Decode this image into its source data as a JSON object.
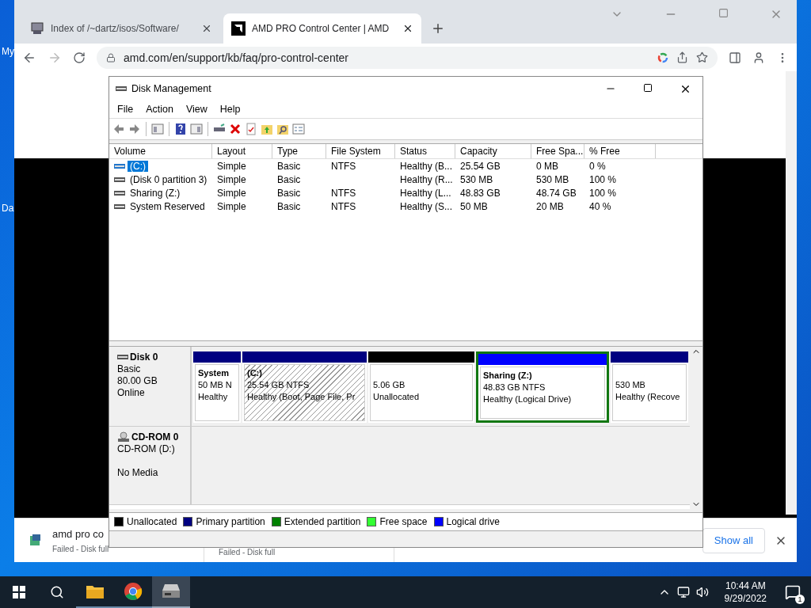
{
  "desktop": {
    "labels": [
      "My",
      "Da"
    ]
  },
  "browser": {
    "tabs": [
      {
        "title": "Index of /~dartz/isos/Software/",
        "selected": false,
        "kind": "computer"
      },
      {
        "title": "AMD PRO Control Center | AMD",
        "selected": true,
        "kind": "amd"
      }
    ],
    "address": "amd.com/en/support/kb/faq/pro-control-center",
    "downloads": [
      {
        "name": "amd pro co",
        "status": "Failed - Disk full"
      },
      {
        "status": "Failed - Disk full"
      }
    ],
    "show_all": "Show all"
  },
  "disk_management": {
    "title": "Disk Management",
    "menu": [
      "File",
      "Action",
      "View",
      "Help"
    ],
    "columns": [
      "Volume",
      "Layout",
      "Type",
      "File System",
      "Status",
      "Capacity",
      "Free Spa...",
      "% Free"
    ],
    "volumes": [
      {
        "cells": [
          "(C:)",
          "Simple",
          "Basic",
          "NTFS",
          "Healthy (B...",
          "25.54 GB",
          "0 MB",
          "0 %"
        ],
        "selected": true
      },
      {
        "cells": [
          "(Disk 0 partition 3)",
          "Simple",
          "Basic",
          "",
          "Healthy (R...",
          "530 MB",
          "530 MB",
          "100 %"
        ],
        "selected": false
      },
      {
        "cells": [
          "Sharing (Z:)",
          "Simple",
          "Basic",
          "NTFS",
          "Healthy (L...",
          "48.83 GB",
          "48.74 GB",
          "100 %"
        ],
        "selected": false
      },
      {
        "cells": [
          "System Reserved",
          "Simple",
          "Basic",
          "NTFS",
          "Healthy (S...",
          "50 MB",
          "20 MB",
          "40 %"
        ],
        "selected": false
      }
    ],
    "disks": [
      {
        "kind": "disk",
        "name": "Disk 0",
        "lines": [
          "Basic",
          "80.00 GB",
          "Online"
        ],
        "partitions": [
          {
            "kind": "primary",
            "title": "System",
            "size": "50 MB N",
            "status": "Healthy",
            "selected": false,
            "in_extended": false
          },
          {
            "kind": "primary",
            "title": "(C:)",
            "size": "25.54 GB NTFS",
            "status": "Healthy (Boot, Page File, Pr",
            "selected": true,
            "in_extended": false
          },
          {
            "kind": "unallocated",
            "size": "5.06 GB",
            "status": "Unallocated",
            "selected": false,
            "in_extended": false
          },
          {
            "kind": "logical",
            "title": "Sharing  (Z:)",
            "size": "48.83 GB NTFS",
            "status": "Healthy (Logical Drive)",
            "selected": false,
            "in_extended": true
          },
          {
            "kind": "primary",
            "size": "530 MB",
            "status": "Healthy (Recove",
            "selected": false,
            "in_extended": false
          }
        ]
      },
      {
        "kind": "cdrom",
        "name": "CD-ROM 0",
        "lines": [
          "CD-ROM (D:)",
          "No Media"
        ]
      }
    ],
    "legend": [
      {
        "label": "Unallocated",
        "color": "#000000"
      },
      {
        "label": "Primary partition",
        "color": "#000080"
      },
      {
        "label": "Extended partition",
        "color": "#008000"
      },
      {
        "label": "Free space",
        "color": "#33ff33"
      },
      {
        "label": "Logical drive",
        "color": "#0000ff"
      }
    ]
  },
  "taskbar": {
    "apps": [
      {
        "kind": "folder",
        "selected": false
      },
      {
        "kind": "chrome",
        "selected": false
      },
      {
        "kind": "diskmgmt",
        "selected": true
      }
    ],
    "time": "10:44 AM",
    "date": "9/29/2022",
    "notifications": "1"
  }
}
